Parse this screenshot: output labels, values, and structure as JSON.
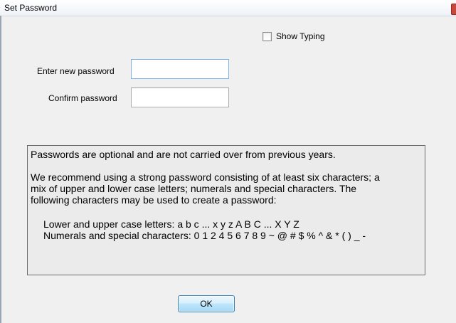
{
  "window": {
    "title": "Set Password"
  },
  "show_typing": {
    "label": "Show Typing",
    "checked": false
  },
  "fields": {
    "new_password_label": "Enter new password",
    "new_password_value": "",
    "confirm_password_label": "Confirm password",
    "confirm_password_value": ""
  },
  "info": {
    "paragraph1": "Passwords are optional and are not carried over from previous years.",
    "paragraph2_line1": "We recommend using a strong password consisting of at least six characters; a",
    "paragraph2_line2": "mix of upper and lower case letters; numerals and special characters. The",
    "paragraph2_line3": "following characters may be used to create a password:",
    "letters_line": "Lower and upper case letters:  a  b  c  ...  x y z A  B  C  ...  X Y Z",
    "specials_line": "Numerals and special characters:  0 1 2 4 5 6 7 8 9 ~ @ # $ % ^ & * ( ) _ -"
  },
  "buttons": {
    "ok_label": "OK"
  }
}
